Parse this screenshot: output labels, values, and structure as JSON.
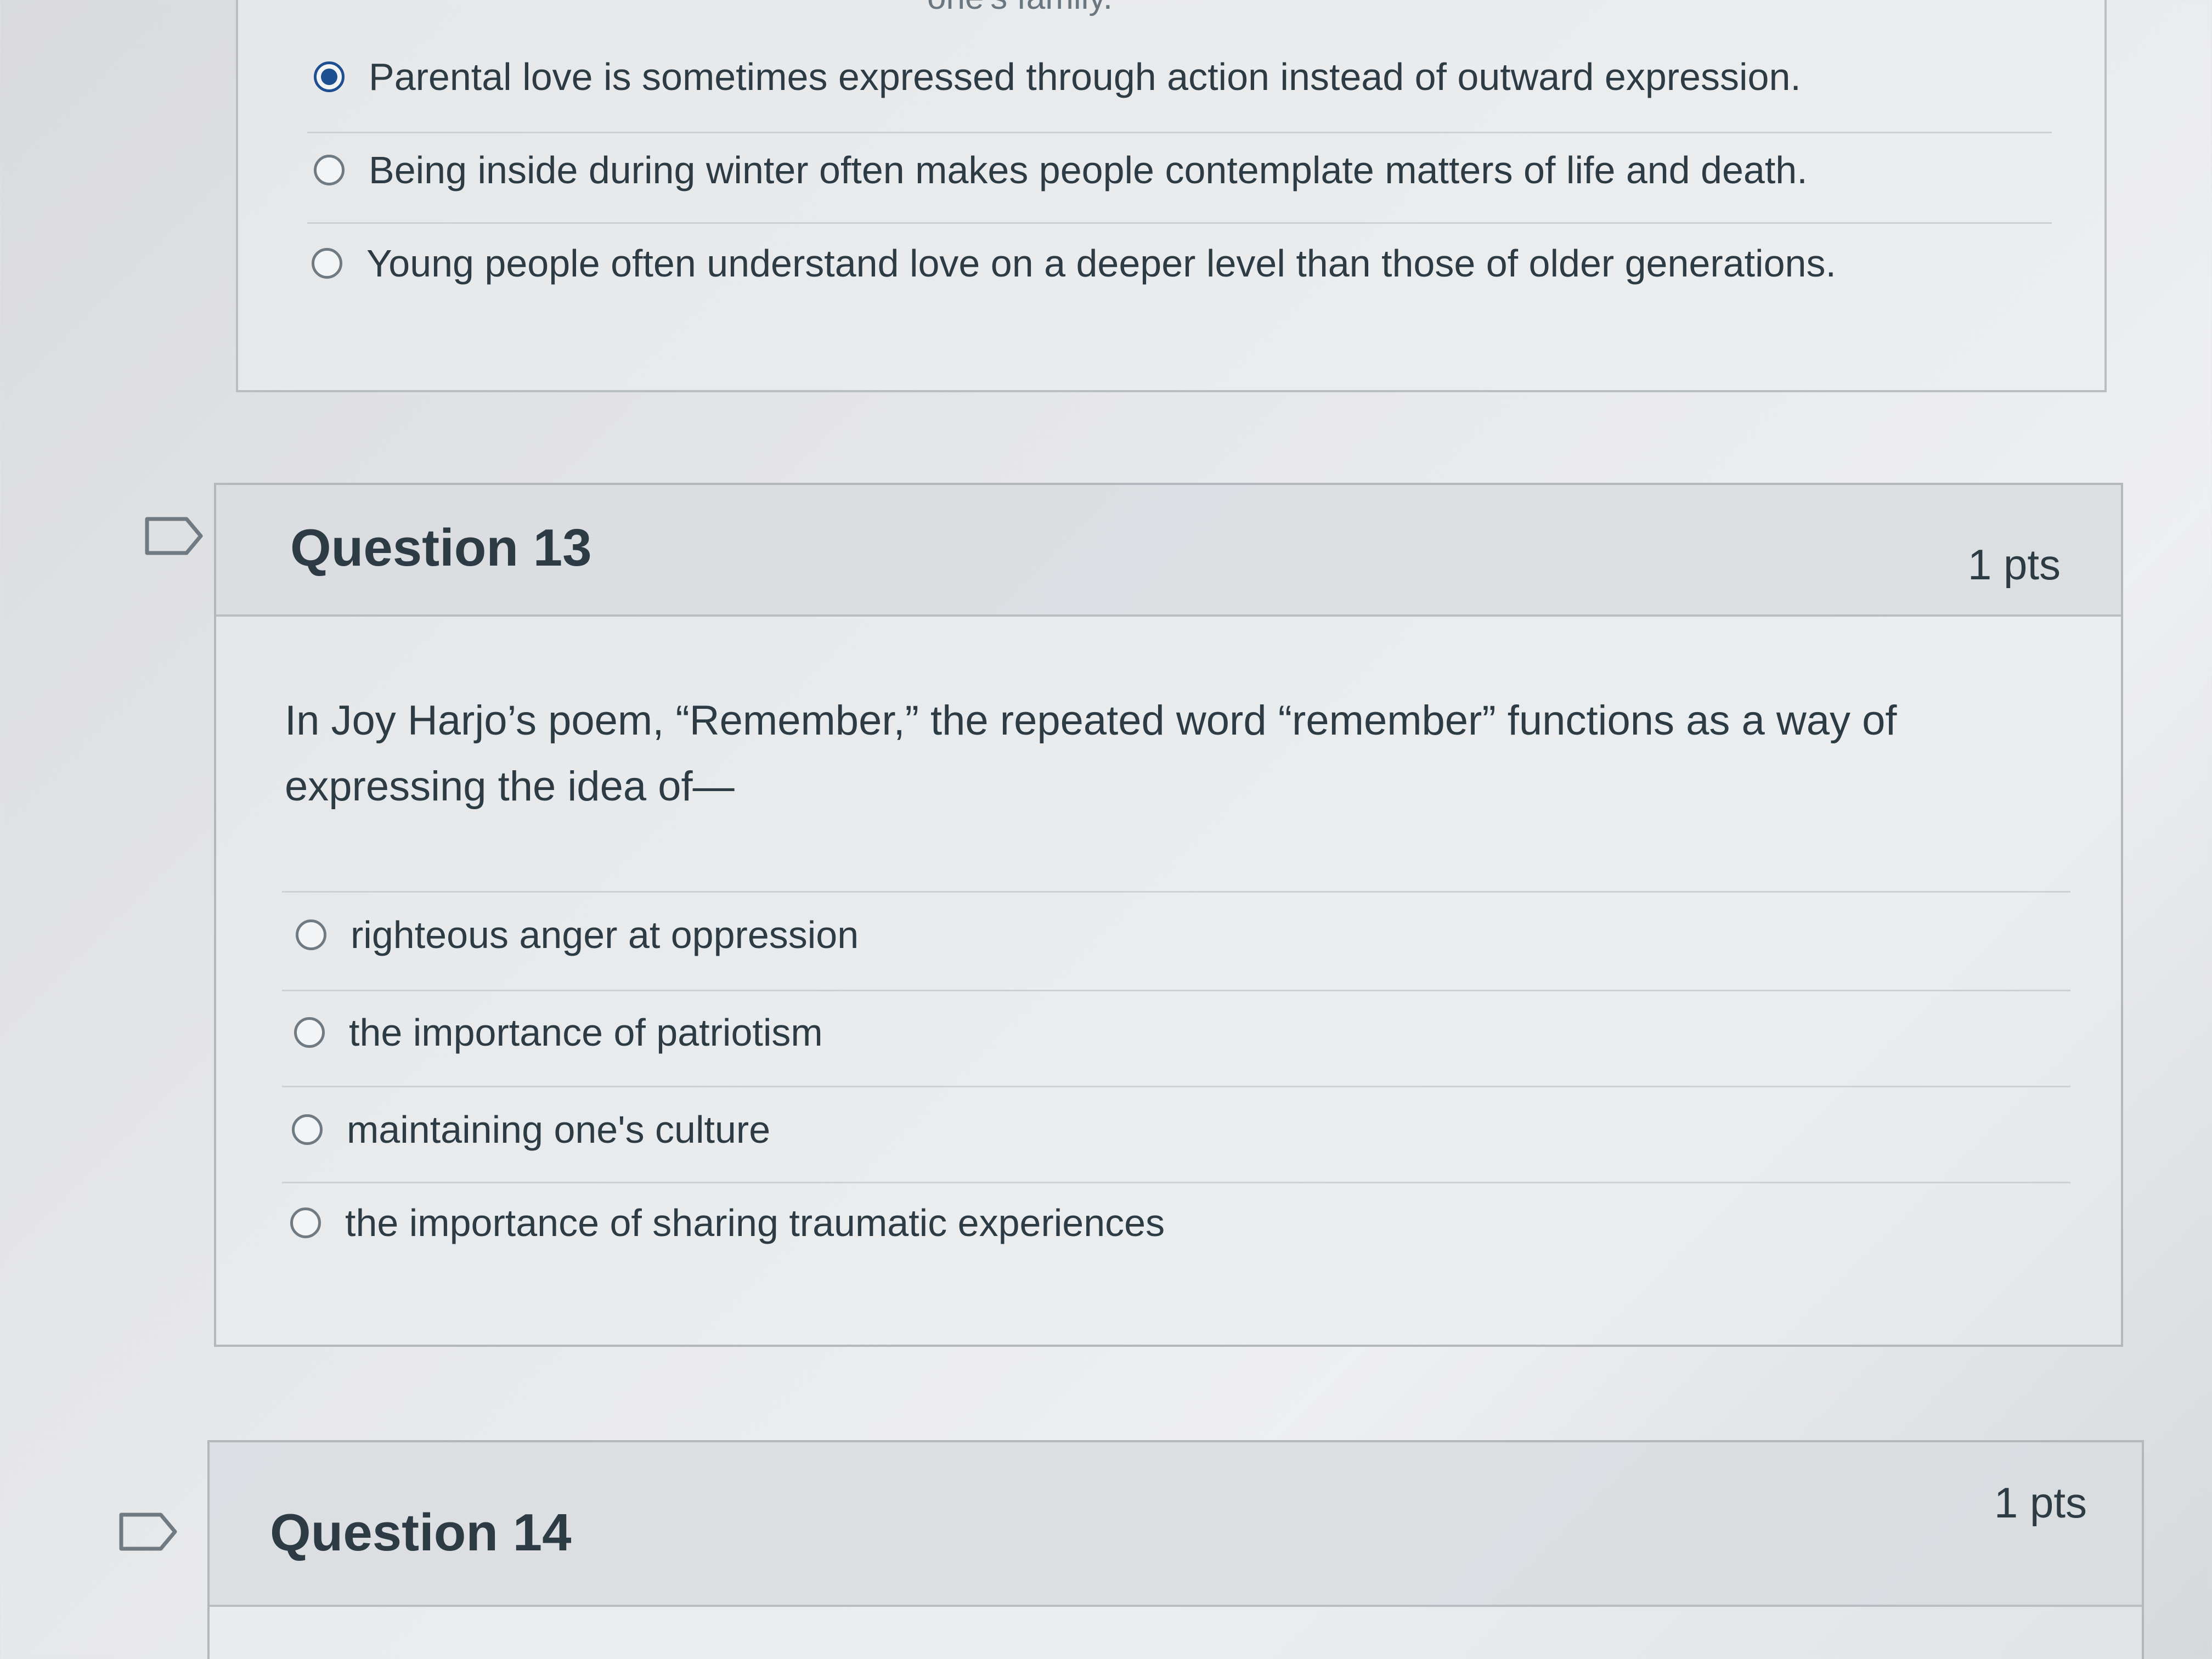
{
  "previous_question": {
    "fragment": "one's family.",
    "answers": [
      {
        "label": "Parental love is sometimes expressed through action instead of outward expression.",
        "selected": true
      },
      {
        "label": "Being inside during winter often makes people contemplate matters of life and death.",
        "selected": false
      },
      {
        "label": "Young people often understand love on a deeper level than those of older generations.",
        "selected": false
      }
    ]
  },
  "question13": {
    "title": "Question 13",
    "points": "1 pts",
    "text": "In Joy Harjo’s poem, “Remember,” the repeated word “remember” functions as a way of expressing the idea of—",
    "answers": [
      {
        "label": "righteous anger at oppression",
        "selected": false
      },
      {
        "label": "the importance of patriotism",
        "selected": false
      },
      {
        "label": "maintaining one's culture",
        "selected": false
      },
      {
        "label": "the importance of sharing traumatic experiences",
        "selected": false
      }
    ]
  },
  "question14": {
    "title": "Question 14",
    "points": "1 pts"
  },
  "icons": {
    "flag": "flag-question-icon",
    "radio": "radio-button-icon"
  },
  "colors": {
    "selected_radio": "#1d4f91",
    "text": "#2d3b45"
  }
}
